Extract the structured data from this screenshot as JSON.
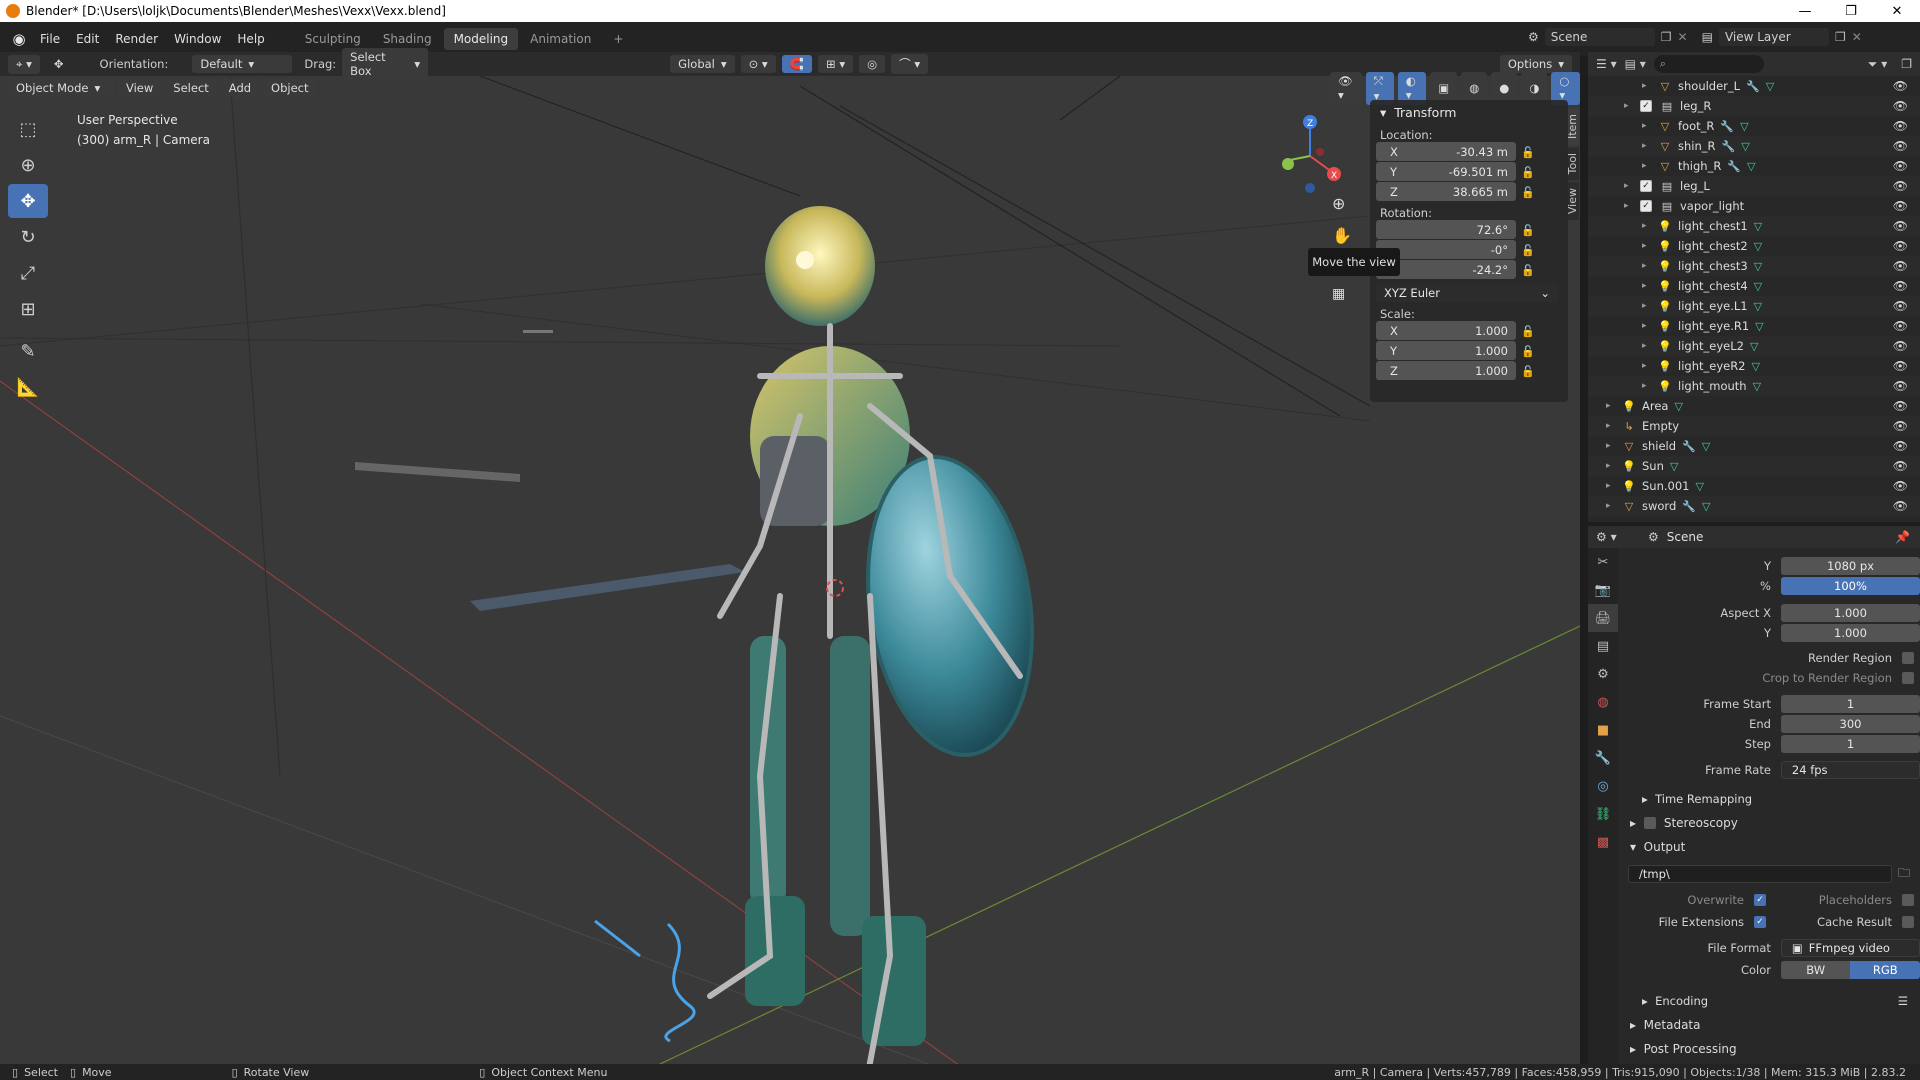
{
  "window": {
    "title": "Blender* [D:\\Users\\loljk\\Documents\\Blender\\Meshes\\Vexx\\Vexx.blend]",
    "controls": [
      "—",
      "❐",
      "✕"
    ]
  },
  "menu": [
    "File",
    "Edit",
    "Render",
    "Window",
    "Help"
  ],
  "workspaces": [
    {
      "label": "Sculpting",
      "active": false
    },
    {
      "label": "Shading",
      "active": false
    },
    {
      "label": "Modeling",
      "active": true
    },
    {
      "label": "Animation",
      "active": false
    }
  ],
  "scene_name": "Scene",
  "view_layer": "View Layer",
  "viewport_header": {
    "orientation_label": "Orientation:",
    "orientation_value": "Default",
    "drag_label": "Drag:",
    "drag_value": "Select Box",
    "transform_space": "Global",
    "options": "Options"
  },
  "viewport_header2": {
    "mode": "Object Mode",
    "menus": [
      "View",
      "Select",
      "Add",
      "Object"
    ]
  },
  "viewport_info": {
    "line1": "User Perspective",
    "line2": "(300) arm_R | Camera"
  },
  "tooltip": "Move the view",
  "transform_panel": {
    "title": "Transform",
    "location_label": "Location:",
    "location": [
      {
        "axis": "X",
        "value": "-30.43 m"
      },
      {
        "axis": "Y",
        "value": "-69.501 m"
      },
      {
        "axis": "Z",
        "value": "38.665 m"
      }
    ],
    "rotation_label": "Rotation:",
    "rotation": [
      {
        "axis": "",
        "value": "72.6°"
      },
      {
        "axis": "",
        "value": "-0°"
      },
      {
        "axis": "Z",
        "value": "-24.2°"
      }
    ],
    "rotation_mode": "XYZ Euler",
    "scale_label": "Scale:",
    "scale": [
      {
        "axis": "X",
        "value": "1.000"
      },
      {
        "axis": "Y",
        "value": "1.000"
      },
      {
        "axis": "Z",
        "value": "1.000"
      }
    ]
  },
  "npanel_tabs": [
    "Item",
    "Tool",
    "View"
  ],
  "outliner": [
    {
      "name": "shoulder_L",
      "indent": 2,
      "type": "bone"
    },
    {
      "name": "leg_R",
      "indent": 1,
      "type": "collection"
    },
    {
      "name": "foot_R",
      "indent": 2,
      "type": "bone"
    },
    {
      "name": "shin_R",
      "indent": 2,
      "type": "bone"
    },
    {
      "name": "thigh_R",
      "indent": 2,
      "type": "bone"
    },
    {
      "name": "leg_L",
      "indent": 1,
      "type": "collection"
    },
    {
      "name": "vapor_light",
      "indent": 1,
      "type": "collection"
    },
    {
      "name": "light_chest1",
      "indent": 2,
      "type": "light"
    },
    {
      "name": "light_chest2",
      "indent": 2,
      "type": "light"
    },
    {
      "name": "light_chest3",
      "indent": 2,
      "type": "light"
    },
    {
      "name": "light_chest4",
      "indent": 2,
      "type": "light"
    },
    {
      "name": "light_eye.L1",
      "indent": 2,
      "type": "light"
    },
    {
      "name": "light_eye.R1",
      "indent": 2,
      "type": "light"
    },
    {
      "name": "light_eyeL2",
      "indent": 2,
      "type": "light"
    },
    {
      "name": "light_eyeR2",
      "indent": 2,
      "type": "light"
    },
    {
      "name": "light_mouth",
      "indent": 2,
      "type": "light"
    },
    {
      "name": "Area",
      "indent": 0,
      "type": "light"
    },
    {
      "name": "Empty",
      "indent": 0,
      "type": "empty"
    },
    {
      "name": "shield",
      "indent": 0,
      "type": "bone"
    },
    {
      "name": "Sun",
      "indent": 0,
      "type": "light"
    },
    {
      "name": "Sun.001",
      "indent": 0,
      "type": "light"
    },
    {
      "name": "sword",
      "indent": 0,
      "type": "bone"
    }
  ],
  "properties": {
    "context": "Scene",
    "resolution_y_label": "Y",
    "resolution_y": "1080 px",
    "percent_label": "%",
    "percent": "100%",
    "aspect_x_label": "Aspect X",
    "aspect_x": "1.000",
    "aspect_y_label": "Y",
    "aspect_y": "1.000",
    "render_region": "Render Region",
    "crop_region": "Crop to Render Region",
    "frame_start_label": "Frame Start",
    "frame_start": "1",
    "end_label": "End",
    "end": "300",
    "step_label": "Step",
    "step": "1",
    "frame_rate_label": "Frame Rate",
    "frame_rate": "24 fps",
    "time_remapping": "Time Remapping",
    "stereoscopy": "Stereoscopy",
    "output": "Output",
    "output_path": "/tmp\\",
    "overwrite": "Overwrite",
    "placeholders": "Placeholders",
    "file_extensions": "File Extensions",
    "cache_result": "Cache Result",
    "file_format_label": "File Format",
    "file_format": "FFmpeg video",
    "color_label": "Color",
    "color_bw": "BW",
    "color_rgb": "RGB",
    "encoding": "Encoding",
    "metadata": "Metadata",
    "post_processing": "Post Processing"
  },
  "statusbar": {
    "select": "Select",
    "move": "Move",
    "rotate": "Rotate View",
    "context_menu": "Object Context Menu",
    "stats": "arm_R | Camera | Verts:457,789 | Faces:458,959 | Tris:915,090 | Objects:1/38 | Mem: 315.3 MiB | 2.83.2"
  },
  "colors": {
    "accent_blue": "#4772b3",
    "axis_red": "#e54c4c",
    "axis_green": "#8bc34a",
    "axis_blue": "#3f7fe0"
  }
}
